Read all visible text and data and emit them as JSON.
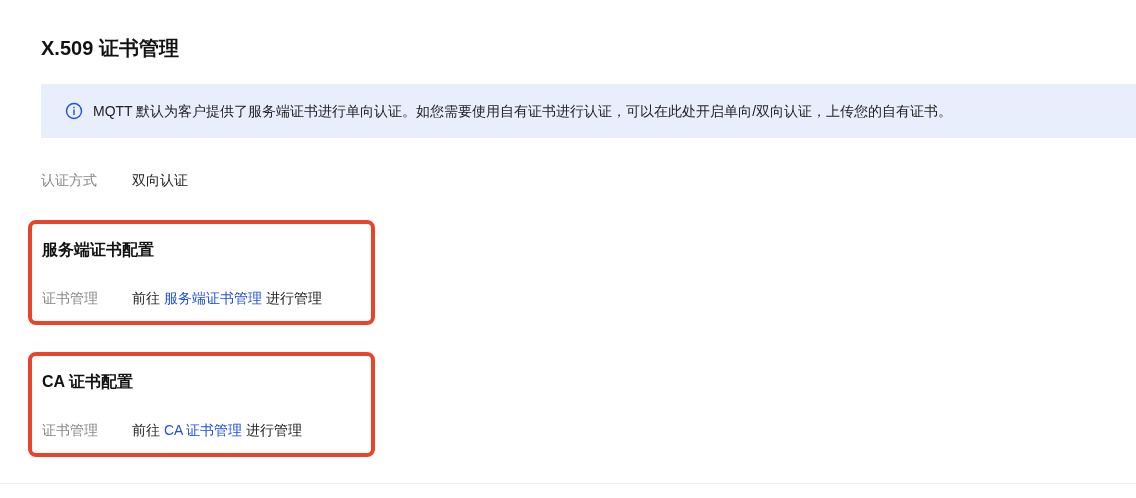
{
  "title": "X.509 证书管理",
  "notice": "MQTT 默认为客户提供了服务端证书进行单向认证。如您需要使用自有证书进行认证，可以在此处开启单向/双向认证，上传您的自有证书。",
  "auth": {
    "label": "认证方式",
    "value": "双向认证"
  },
  "sections": [
    {
      "title": "服务端证书配置",
      "label": "证书管理",
      "prefix": "前往",
      "link": "服务端证书管理",
      "suffix": "进行管理"
    },
    {
      "title": "CA 证书配置",
      "label": "证书管理",
      "prefix": "前往",
      "link": "CA 证书管理",
      "suffix": "进行管理"
    }
  ]
}
